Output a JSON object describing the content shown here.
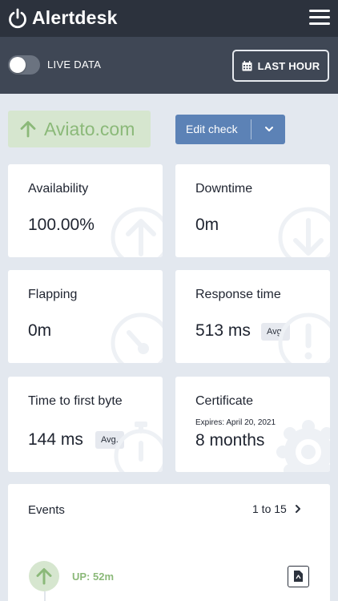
{
  "app": {
    "title": "Alertdesk"
  },
  "toolbar": {
    "live_label": "LIVE DATA",
    "live_enabled": false,
    "range_label": "LAST HOUR"
  },
  "check": {
    "site_name": "Aviato.com",
    "status": "up",
    "edit_label": "Edit check"
  },
  "metrics": {
    "availability": {
      "title": "Availability",
      "value": "100.00%"
    },
    "downtime": {
      "title": "Downtime",
      "value": "0m"
    },
    "flapping": {
      "title": "Flapping",
      "value": "0m"
    },
    "response_time": {
      "title": "Response time",
      "value": "513 ms",
      "badge": "Avg."
    },
    "ttfb": {
      "title": "Time to first byte",
      "value": "144 ms",
      "badge": "Avg."
    },
    "certificate": {
      "title": "Certificate",
      "note": "Expires: April 20, 2021",
      "value": "8 months"
    }
  },
  "events": {
    "title": "Events",
    "range": "1 to 15",
    "items": [
      {
        "status": "UP: 52m"
      }
    ]
  },
  "colors": {
    "up_green": "#8bb979",
    "accent_blue": "#5c82b6",
    "header_dark": "#2c323d",
    "toolbar_grey": "#3f4755"
  }
}
